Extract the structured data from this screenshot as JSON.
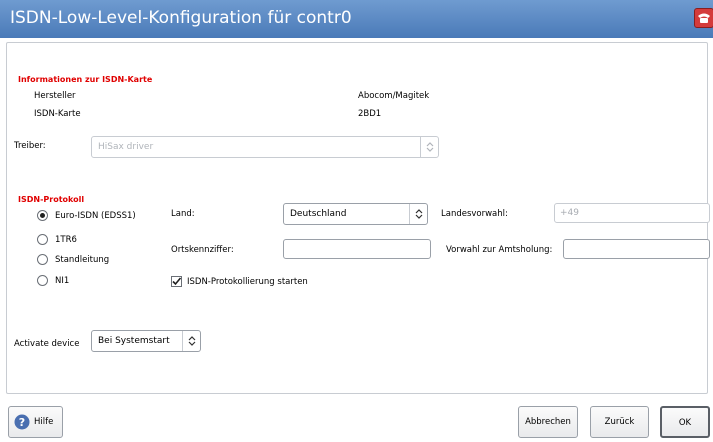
{
  "window": {
    "title": "ISDN-Low-Level-Konfiguration für contr0",
    "icon": "isdn-phone-icon"
  },
  "card_info": {
    "heading": "Informationen zur ISDN-Karte",
    "rows": [
      {
        "label": "Hersteller",
        "value": "Abocom/Magitek"
      },
      {
        "label": "ISDN-Karte",
        "value": "2BD1"
      }
    ]
  },
  "driver": {
    "label": "Treiber:",
    "value": "HiSax driver",
    "disabled": true
  },
  "protocol": {
    "heading": "ISDN-Protokoll",
    "options": [
      {
        "label": "Euro-ISDN (EDSS1)",
        "selected": true
      },
      {
        "label": "1TR6",
        "selected": false
      },
      {
        "label": "Standleitung",
        "selected": false
      },
      {
        "label": "NI1",
        "selected": false
      }
    ]
  },
  "country": {
    "label": "Land:",
    "value": "Deutschland"
  },
  "country_code": {
    "label": "Landesvorwahl:",
    "value": "+49"
  },
  "area_code": {
    "label": "Ortskennziffer:",
    "value": ""
  },
  "outside_line": {
    "label": "Vorwahl zur Amtsholung:",
    "value": ""
  },
  "logging": {
    "label": "ISDN-Protokollierung starten",
    "checked": true
  },
  "activate": {
    "label": "Activate device",
    "value": "Bei Systemstart"
  },
  "buttons": {
    "help": "Hilfe",
    "cancel": "Abbrechen",
    "back": "Zurück",
    "ok": "OK"
  }
}
